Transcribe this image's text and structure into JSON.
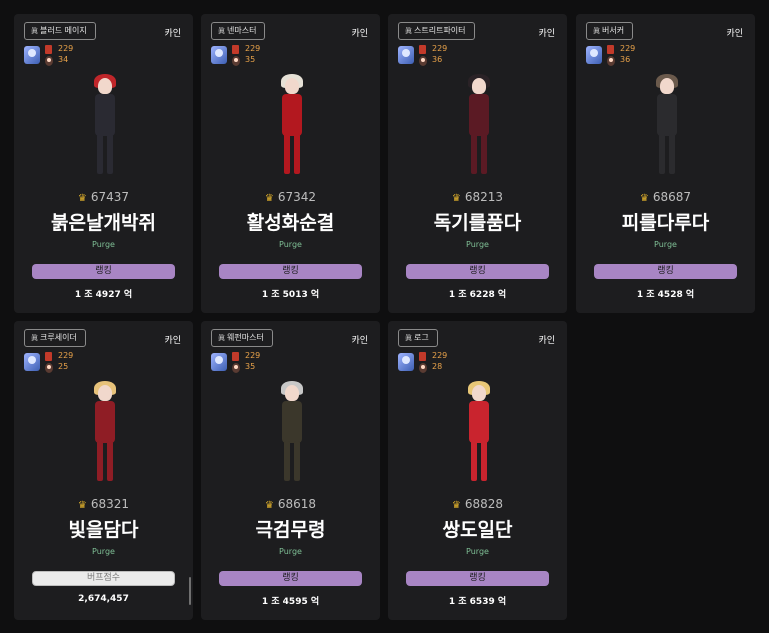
{
  "cards": [
    {
      "job": "블러드 메이지",
      "server": "카인",
      "level": "229",
      "fame": "34",
      "fame_score": "67437",
      "name": "붉은날개박쥐",
      "guild": "Purge",
      "button": "랭킹",
      "value": "1 조 4927 억",
      "colors": {
        "hair": "#c0262a",
        "body": "#2a2a32"
      }
    },
    {
      "job": "넨마스터",
      "server": "카인",
      "level": "229",
      "fame": "35",
      "fame_score": "67342",
      "name": "활성화순결",
      "guild": "Purge",
      "button": "랭킹",
      "value": "1 조 5013 억",
      "colors": {
        "hair": "#e6e1d6",
        "body": "#b3181f"
      }
    },
    {
      "job": "스트리트파이터",
      "server": "카인",
      "level": "229",
      "fame": "36",
      "fame_score": "68213",
      "name": "독기를품다",
      "guild": "Purge",
      "button": "랭킹",
      "value": "1 조 6228 억",
      "colors": {
        "hair": "#2a2226",
        "body": "#5b1a24"
      }
    },
    {
      "job": "버서커",
      "server": "카인",
      "level": "229",
      "fame": "36",
      "fame_score": "68687",
      "name": "피를다루다",
      "guild": "Purge",
      "button": "랭킹",
      "value": "1 조 4528 억",
      "colors": {
        "hair": "#6b5a4c",
        "body": "#2b2b2e"
      }
    },
    {
      "job": "크루세이더",
      "server": "카인",
      "level": "229",
      "fame": "25",
      "fame_score": "68321",
      "name": "빛을담다",
      "guild": "Purge",
      "button": "버프점수",
      "value": "2,674,457",
      "colors": {
        "hair": "#e7c27a",
        "body": "#8f1d25"
      }
    },
    {
      "job": "웨펀마스터",
      "server": "카인",
      "level": "229",
      "fame": "35",
      "fame_score": "68618",
      "name": "극검무령",
      "guild": "Purge",
      "button": "랭킹",
      "value": "1 조 4595 억",
      "colors": {
        "hair": "#c8c8c8",
        "body": "#3b372b"
      }
    },
    {
      "job": "로그",
      "server": "카인",
      "level": "229",
      "fame": "28",
      "fame_score": "68828",
      "name": "쌍도일단",
      "guild": "Purge",
      "button": "랭킹",
      "value": "1 조 6539 억",
      "colors": {
        "hair": "#e8c777",
        "body": "#c9242e"
      }
    }
  ]
}
